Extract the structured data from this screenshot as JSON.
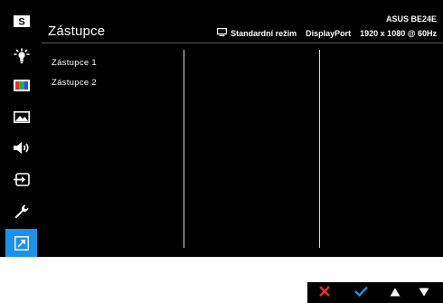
{
  "colors": {
    "osd_background": "#000000",
    "sidebar_active": "#1e90ea",
    "text": "#ffffff",
    "cancel": "#e0322c",
    "confirm": "#1e90ea"
  },
  "sidebar": {
    "items": [
      {
        "icon": "splendid-s-icon",
        "active": false
      },
      {
        "icon": "blue-light-filter-icon",
        "active": false
      },
      {
        "icon": "color-bars-icon",
        "active": false
      },
      {
        "icon": "image-icon",
        "active": false
      },
      {
        "icon": "speaker-icon",
        "active": false
      },
      {
        "icon": "input-select-icon",
        "active": false
      },
      {
        "icon": "wrench-icon",
        "active": false
      },
      {
        "icon": "shortcut-arrow-icon",
        "active": true
      }
    ]
  },
  "header": {
    "title": "Zástupce",
    "model": "ASUS BE24E",
    "mode": "Standardní režim",
    "input": "DisplayPort",
    "resolution": "1920 x 1080 @ 60Hz"
  },
  "menu": {
    "items": [
      "Zástupce 1",
      "Zástupce 2"
    ]
  },
  "navbar": {
    "buttons": [
      "cancel-icon",
      "confirm-icon",
      "up-arrow-icon",
      "down-arrow-icon"
    ]
  }
}
